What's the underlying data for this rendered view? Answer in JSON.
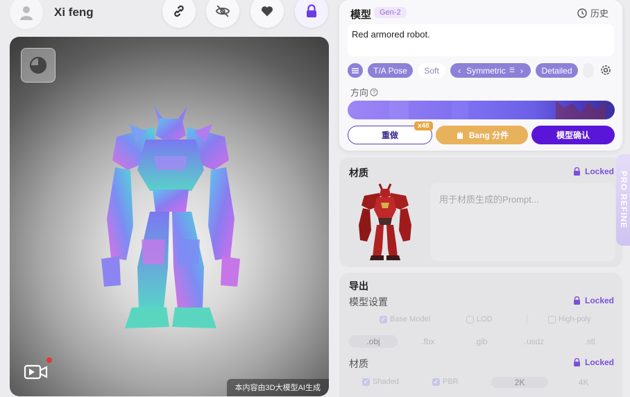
{
  "user": {
    "name": "Xi feng"
  },
  "toolbar": {
    "icons": [
      "link-icon",
      "eye-off-icon",
      "heart-icon",
      "lock-icon"
    ]
  },
  "viewport": {
    "caption": "本内容由3D大模型AI生成"
  },
  "model": {
    "title": "模型",
    "badge": "Gen-2",
    "history_label": "历史",
    "prompt": "Red armored robot.",
    "options": {
      "pose": "T/A Pose",
      "soft": "Soft",
      "symmetric": "Symmetric",
      "detailed": "Detailed"
    },
    "direction_label": "方向",
    "redo_label": "重做",
    "redo_badge": "x48",
    "bang_label": "Bang 分件",
    "confirm_label": "模型确认"
  },
  "material": {
    "title": "材质",
    "locked_label": "Locked",
    "prompt_placeholder": "用于材质生成的Prompt..."
  },
  "pro_refine": "PRO REFINE",
  "export": {
    "title": "导出",
    "model_settings": {
      "title": "模型设置",
      "locked_label": "Locked",
      "options": {
        "base": "Base Model",
        "lod": "LOD",
        "high": "High-poly"
      }
    },
    "formats": [
      ".obj",
      ".fbx",
      ".glb",
      ".usdz",
      ".stl"
    ],
    "material": {
      "title": "材质",
      "locked_label": "Locked",
      "shaded": "Shaded",
      "pbr": "PBR",
      "res_2k": "2K",
      "res_4k": "4K"
    }
  },
  "colors": {
    "accent": "#5a16d8",
    "bang": "#e8b15c",
    "locked": "#7a52d8"
  }
}
